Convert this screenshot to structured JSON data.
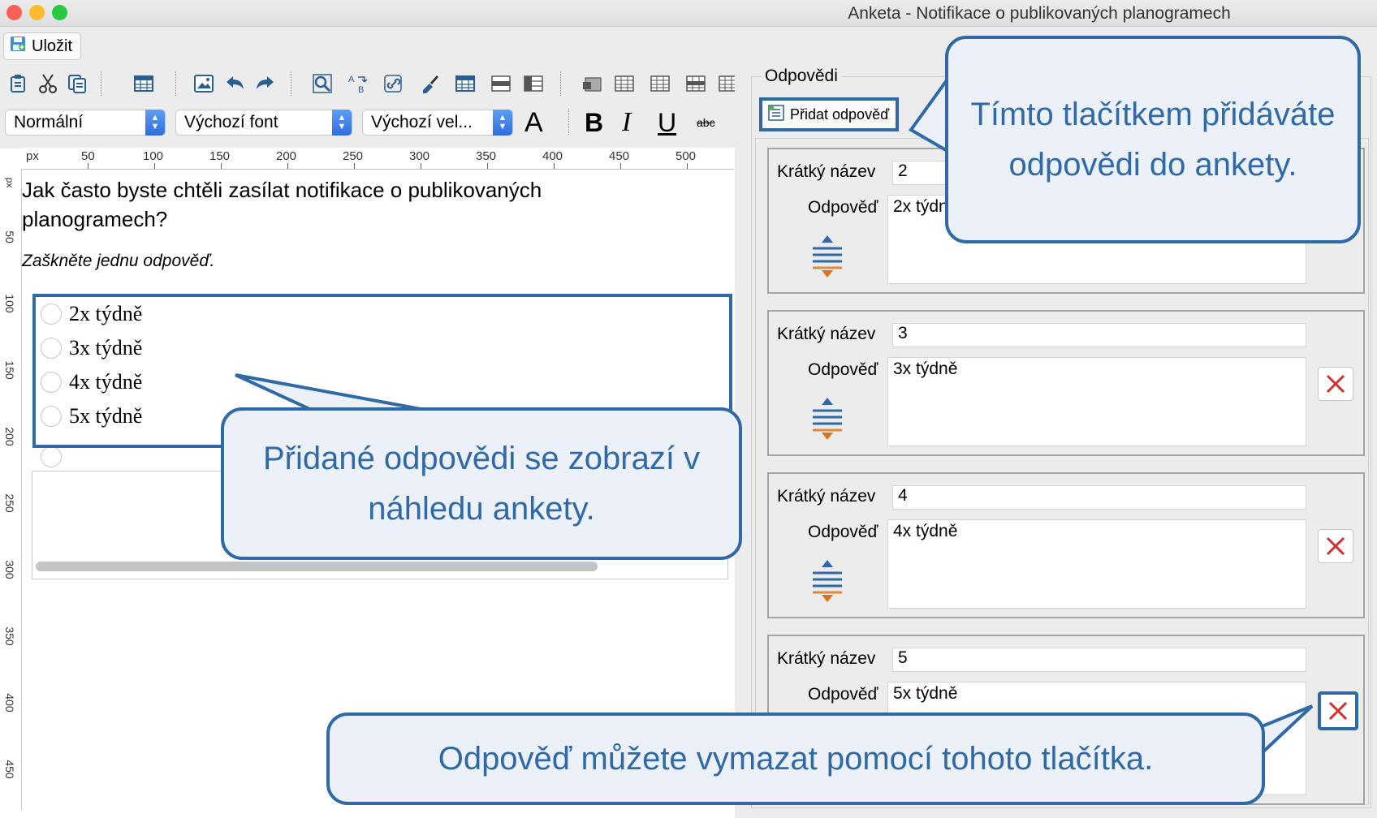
{
  "window": {
    "title": "Anketa - Notifikace o publikovaných planogramech"
  },
  "toolbar": {
    "save_label": "Uložit"
  },
  "format_bar": {
    "style_value": "Normální",
    "font_value": "Výchozí font",
    "size_value": "Výchozí vel...",
    "font_color_glyph": "A",
    "bold": "B",
    "italic": "I",
    "underline": "U",
    "strike": "abc"
  },
  "ruler": {
    "unit_h": "px",
    "unit_v": "px",
    "h_marks": [
      "50",
      "100",
      "150",
      "200",
      "250",
      "300",
      "350",
      "400",
      "450",
      "500"
    ],
    "v_marks": [
      "50",
      "100",
      "150",
      "200",
      "250",
      "300",
      "350",
      "400",
      "450"
    ]
  },
  "preview": {
    "question": "Jak často byste chtěli zasílat notifikace o publikovaných planogramech?",
    "instruction": "Zaškněte jednu odpověď.",
    "options": [
      "2x týdně",
      "3x týdně",
      "4x týdně",
      "5x týdně"
    ]
  },
  "answers_panel": {
    "legend": "Odpovědi",
    "add_button": "Přidat odpověď",
    "short_name_label": "Krátký název",
    "answer_label": "Odpověď",
    "cards": [
      {
        "short_name": "2",
        "answer": "2x týdně"
      },
      {
        "short_name": "3",
        "answer": "3x týdně"
      },
      {
        "short_name": "4",
        "answer": "4x týdně"
      },
      {
        "short_name": "5",
        "answer": "5x týdně"
      }
    ]
  },
  "callouts": {
    "add_answers": "Tímto tlačítkem přidáváte odpovědi do ankety.",
    "preview": "Přidané odpovědi se zobrazí v náhledu ankety.",
    "delete": "Odpověď můžete vymazat pomocí tohoto tlačítka."
  },
  "colors": {
    "accent": "#2f6aa6",
    "delete": "#d32f2f",
    "callout_bg": "#ecf0f7"
  }
}
